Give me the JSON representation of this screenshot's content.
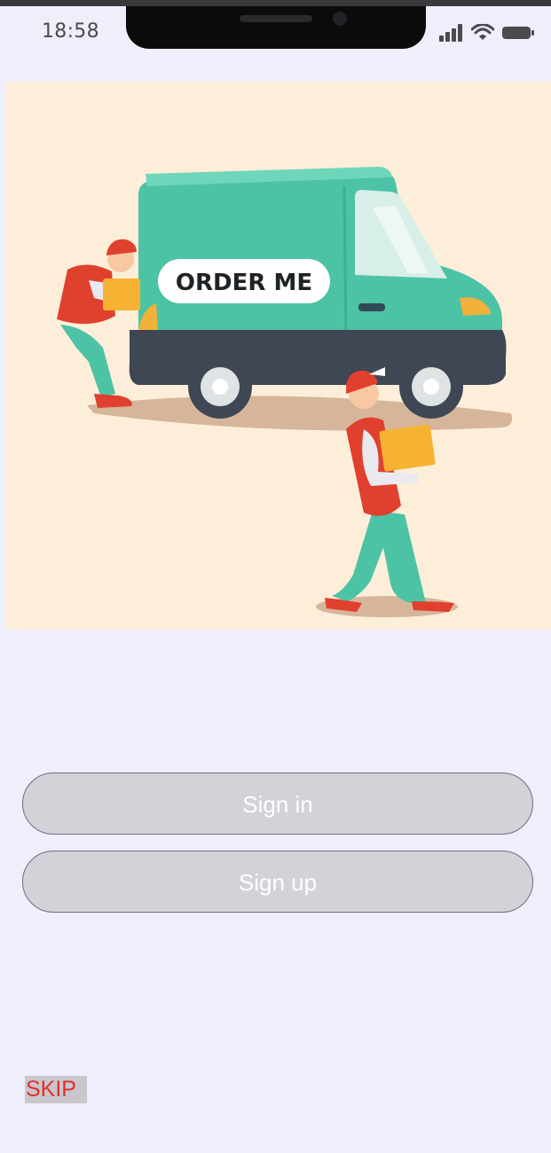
{
  "status_bar": {
    "time": "18:58",
    "icons": [
      "signal-icon",
      "wifi-icon",
      "battery-icon"
    ]
  },
  "hero": {
    "van_sign": "ORDER ME"
  },
  "actions": {
    "sign_in_label": "Sign in",
    "sign_up_label": "Sign up",
    "skip_label": "SKIP"
  },
  "colors": {
    "background": "#efeefb",
    "hero_background": "#fdeed9",
    "van": "#4cc3a4",
    "button_fill": "#d4d1d8",
    "skip_text": "#e0312b"
  }
}
